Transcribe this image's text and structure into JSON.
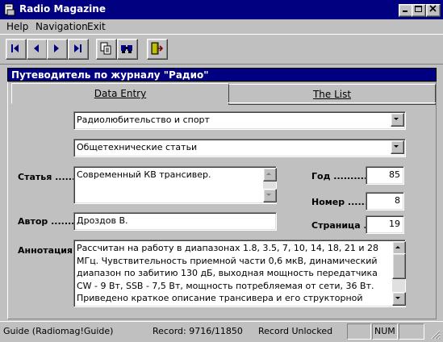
{
  "window": {
    "title": "Radio Magazine"
  },
  "menu": {
    "help": "Help",
    "navigation": "Navigation",
    "exit": "Exit"
  },
  "form": {
    "header": "Путеводитель по журналу \"Радио\"",
    "tabs": [
      {
        "label": "Data Entry"
      },
      {
        "label": "The List"
      }
    ],
    "category": "Радиолюбительство и спорт",
    "subcategory": "Общетехнические статьи",
    "labels": {
      "article": "Статья .........",
      "author": "Автор ..........",
      "annotation": "Аннотация...",
      "year": "Год .............",
      "number": "Номер ........",
      "page": "Страница ..."
    },
    "article": "Современный КВ трансивер.",
    "author": "Дроздов В.",
    "year": "85",
    "number": "8",
    "page": "19",
    "annotation": "Рассчитан на работу в диапазонах 1.8, 3.5, 7, 10, 14, 18, 21 и 28 МГц. Чувствительность приемной части 0,6 мкВ, динамический диапазон по забитию 130 дБ, выходная мощность передатчика CW - 9 Вт, SSB - 7,5 Вт, мощность потребляемая от сети, 36 Вт. Приведено краткое описание трансивера и его структорной схемы. В последующих статьях"
  },
  "status": {
    "guide": "Guide (Radiomag!Guide)",
    "record": "Record: 9716/11850",
    "lock": "Record Unlocked",
    "num": "NUM"
  },
  "icons": [
    "app-icon",
    "minimize-icon",
    "maximize-icon",
    "close-icon",
    "first-record-icon",
    "prev-record-icon",
    "next-record-icon",
    "last-record-icon",
    "copy-icon",
    "search-icon",
    "exit-door-icon"
  ]
}
